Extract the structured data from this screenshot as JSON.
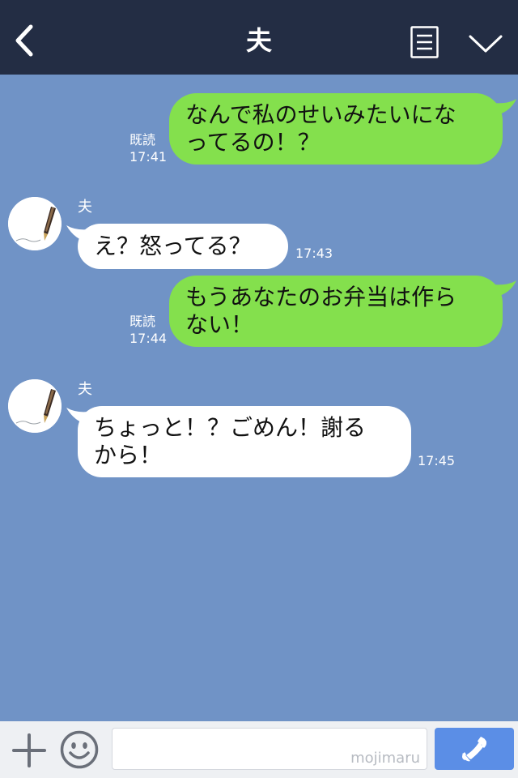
{
  "header": {
    "title": "夫",
    "back_icon": "chevron-left-icon",
    "menu_icon": "list-menu-icon",
    "collapse_icon": "chevron-down-icon",
    "background": "#232d44"
  },
  "chat": {
    "background": "#7093c6",
    "messages": [
      {
        "direction": "sent",
        "text": "なんで私のせいみたいにな\nってるの！？",
        "read_label": "既読",
        "time": "17:41"
      },
      {
        "direction": "received",
        "sender": "夫",
        "text": "え？怒ってる？",
        "time": "17:43"
      },
      {
        "direction": "sent",
        "text": "もうあなたのお弁当は作ら\nない！",
        "read_label": "既読",
        "time": "17:44"
      },
      {
        "direction": "received",
        "sender": "夫",
        "text": "ちょっと！？ごめん！謝る\nから！",
        "time": "17:45"
      }
    ],
    "sent_bubble_color": "#84e04d",
    "received_bubble_color": "#ffffff"
  },
  "input_bar": {
    "plus_icon": "plus-icon",
    "emoji_icon": "smiley-icon",
    "input_value": "",
    "watermark": "mojimaru",
    "call_icon": "phone-icon",
    "call_button_color": "#5b8ee6"
  }
}
